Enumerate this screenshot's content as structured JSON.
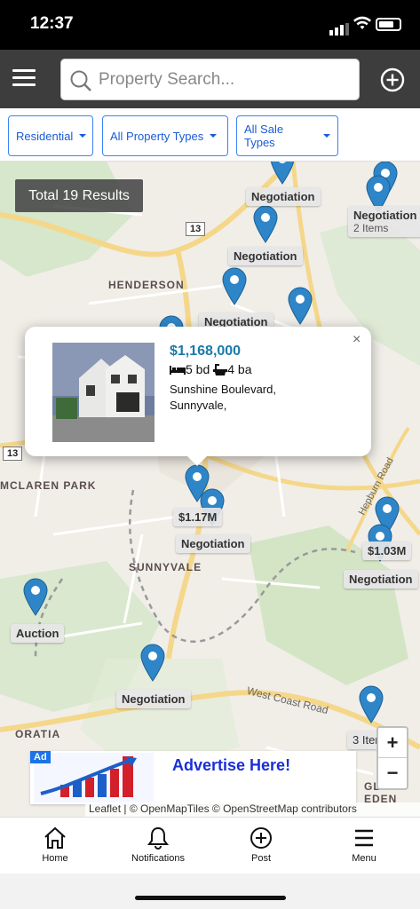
{
  "status": {
    "time": "12:37"
  },
  "search": {
    "placeholder": "Property Search..."
  },
  "filters": {
    "residential": "Residential",
    "property_types": "All Property Types",
    "sale_types": "All Sale Types"
  },
  "map": {
    "total": "Total 19 Results",
    "places": {
      "henderson": "HENDERSON",
      "mclaren_park": "MCLAREN PARK",
      "sunnyvale": "SUNNYVALE",
      "oratia": "ORATIA",
      "glen_eden": "GLEN EDEN"
    },
    "roads": {
      "west_coast": "West Coast Road",
      "hepburn": "Hepburn Road",
      "route_a": "13",
      "route_b": "13"
    },
    "labels": {
      "n1": "Negotiation",
      "n2": "Negotiation",
      "n2_sub": "2 Items",
      "n3": "Negotiation",
      "n4": "Negotiation",
      "price1": "$1.17M",
      "n5": "Negotiation",
      "price2": "$1.03M",
      "n6": "Negotiation",
      "auction": "Auction",
      "n7": "Negotiation",
      "items3": "3 Items"
    },
    "popup": {
      "price": "$1,168,000",
      "beds": "5 bd",
      "baths": "4 ba",
      "address_line1": "Sunshine Boulevard,",
      "address_line2": "Sunnyvale,",
      "close": "×"
    },
    "zoom": {
      "in": "+",
      "out": "−"
    },
    "ad": {
      "badge": "Ad",
      "text": "Advertise Here!"
    },
    "attribution": "Leaflet | © OpenMapTiles © OpenStreetMap contributors"
  },
  "tabs": {
    "home": "Home",
    "notifications": "Notifications",
    "post": "Post",
    "menu": "Menu"
  },
  "colors": {
    "pin": "#2e86c8",
    "filter": "#1a5bd6",
    "price": "#1a7aa8",
    "topbar": "#3d3d3d"
  }
}
